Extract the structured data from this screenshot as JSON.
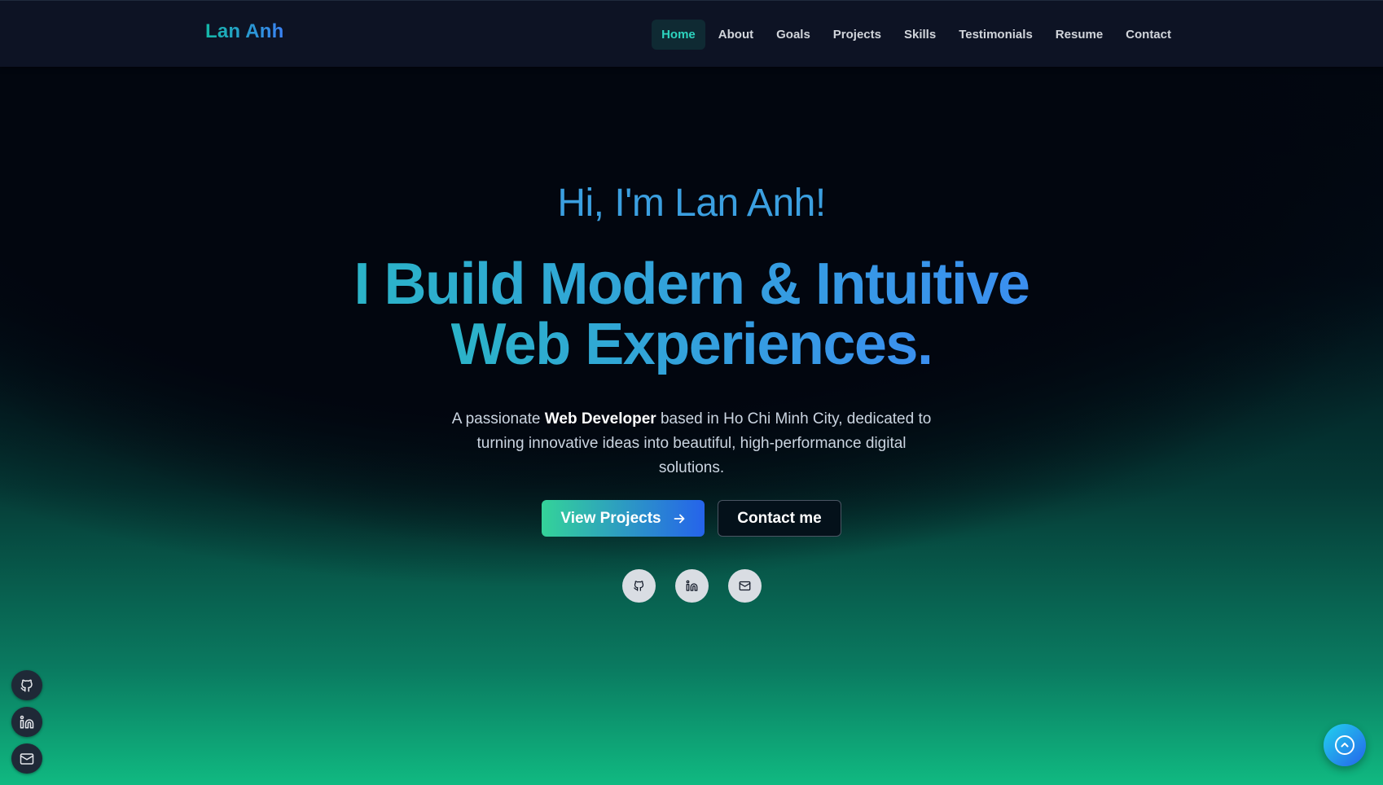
{
  "brand": "Lan Anh",
  "nav": {
    "items": [
      {
        "label": "Home",
        "active": true
      },
      {
        "label": "About"
      },
      {
        "label": "Goals"
      },
      {
        "label": "Projects"
      },
      {
        "label": "Skills"
      },
      {
        "label": "Testimonials"
      },
      {
        "label": "Resume"
      },
      {
        "label": "Contact"
      }
    ]
  },
  "hero": {
    "greeting": "Hi, I'm Lan Anh!",
    "headline_line1": "I Build Modern & Intuitive",
    "headline_line2": "Web Experiences.",
    "desc_prefix": "A passionate ",
    "desc_bold": "Web Developer",
    "desc_suffix": " based in Ho Chi Minh City, dedicated to turning innovative ideas into beautiful, high-performance digital solutions.",
    "primary_button": "View Projects",
    "secondary_button": "Contact me"
  },
  "social": {
    "icons": [
      "github-icon",
      "linkedin-icon",
      "mail-icon"
    ]
  },
  "colors": {
    "accent_teal": "#2dd4bf",
    "accent_blue": "#3b82f6",
    "nav_bg": "#0d1324",
    "bottom_green": "#10b981"
  }
}
